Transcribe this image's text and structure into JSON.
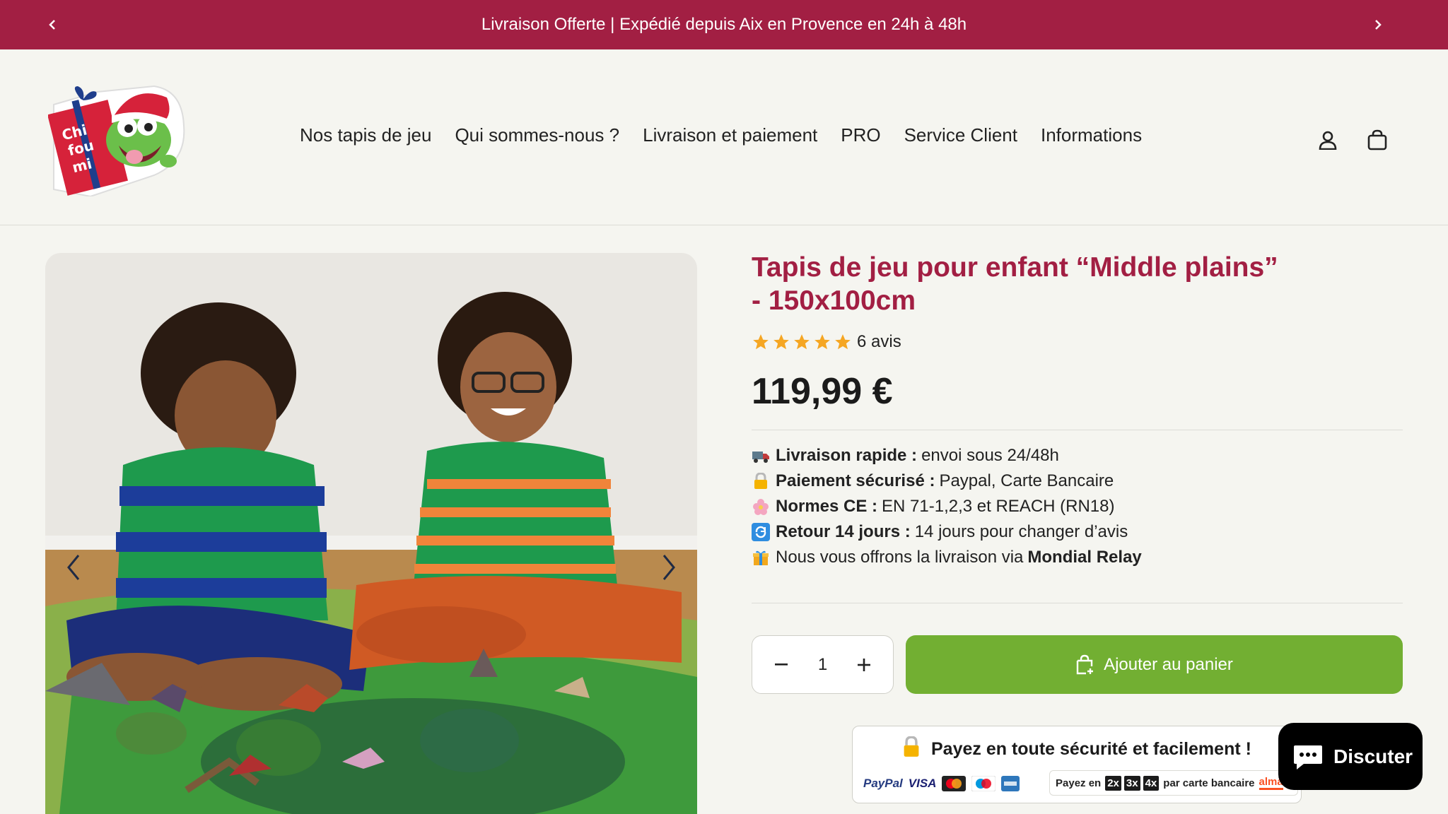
{
  "announcement": {
    "text": "Livraison Offerte | Expédié depuis Aix en Provence en 24h à 48h"
  },
  "brand": {
    "logo_text": [
      "Chi",
      "fou",
      "mi"
    ],
    "primary_color": "#a21f43",
    "accent_color": "#72af32"
  },
  "nav": {
    "items": [
      {
        "label": "Nos tapis de jeu"
      },
      {
        "label": "Qui sommes-nous ?"
      },
      {
        "label": "Livraison et paiement"
      },
      {
        "label": "PRO"
      },
      {
        "label": "Service Client"
      },
      {
        "label": "Informations"
      }
    ]
  },
  "header_icons": [
    "account-icon",
    "cart-icon"
  ],
  "product": {
    "title": "Tapis de jeu pour enfant “Middle plains” - 150x100cm",
    "rating": {
      "stars": 5,
      "count_label": "6 avis"
    },
    "price": "119,99 €",
    "features": [
      {
        "icon": "truck-icon",
        "bold": "Livraison rapide :",
        "text": "envoi sous 24/48h"
      },
      {
        "icon": "lock-icon",
        "bold": "Paiement sécurisé :",
        "text": "Paypal, Carte Bancaire"
      },
      {
        "icon": "flower-icon",
        "bold": "Normes CE :",
        "text": "EN 71-1,2,3 et REACH (RN18)"
      },
      {
        "icon": "return-icon",
        "bold": "Retour 14 jours :",
        "text": "14 jours pour changer d’avis"
      }
    ],
    "gift_line": {
      "icon": "gift-icon",
      "text": "Nous vous offrons la livraison via",
      "bold": "Mondial Relay"
    },
    "quantity": "1",
    "add_to_cart_label": "Ajouter au panier"
  },
  "payment": {
    "title": "Payez en toute sécurité et facilement !",
    "logos": [
      "PayPal",
      "VISA",
      "mastercard",
      "maestro",
      "amex"
    ],
    "alma": {
      "prefix": "Payez en",
      "options": [
        "2x",
        "3x",
        "4x"
      ],
      "suffix": "par carte bancaire",
      "brand": "alma"
    }
  },
  "chat": {
    "label": "Discuter"
  }
}
